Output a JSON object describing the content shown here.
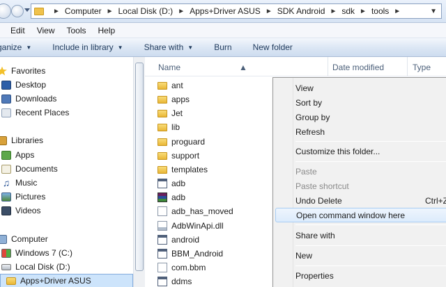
{
  "address": {
    "crumbs": [
      "Computer",
      "Local Disk (D:)",
      "Apps+Driver ASUS",
      "SDK Android",
      "sdk",
      "tools"
    ]
  },
  "menubar": [
    "Edit",
    "View",
    "Tools",
    "Help"
  ],
  "commands": {
    "organize": "rganize",
    "include": "Include in library",
    "share": "Share with",
    "burn": "Burn",
    "newfolder": "New folder"
  },
  "nav": {
    "favorites": "Favorites",
    "desktop": "Desktop",
    "downloads": "Downloads",
    "recent": "Recent Places",
    "libraries": "Libraries",
    "apps": "Apps",
    "documents": "Documents",
    "music": "Music",
    "pictures": "Pictures",
    "videos": "Videos",
    "computer": "Computer",
    "win7": "Windows 7 (C:)",
    "localdisk": "Local Disk (D:)",
    "appsdriver": "Apps+Driver ASUS"
  },
  "columns": {
    "name": "Name",
    "date": "Date modified",
    "type": "Type"
  },
  "files": [
    "ant",
    "apps",
    "Jet",
    "lib",
    "proguard",
    "support",
    "templates",
    "adb",
    "adb",
    "adb_has_moved",
    "AdbWinApi.dll",
    "android",
    "BBM_Android",
    "com.bbm",
    "ddms"
  ],
  "context_menu": {
    "view": "View",
    "sortby": "Sort by",
    "groupby": "Group by",
    "refresh": "Refresh",
    "customize": "Customize this folder...",
    "paste": "Paste",
    "paste_shortcut": "Paste shortcut",
    "undo": "Undo Delete",
    "undo_shortcut": "Ctrl+Z",
    "open_cmd": "Open command window here",
    "sharewith": "Share with",
    "new": "New",
    "properties": "Properties"
  }
}
